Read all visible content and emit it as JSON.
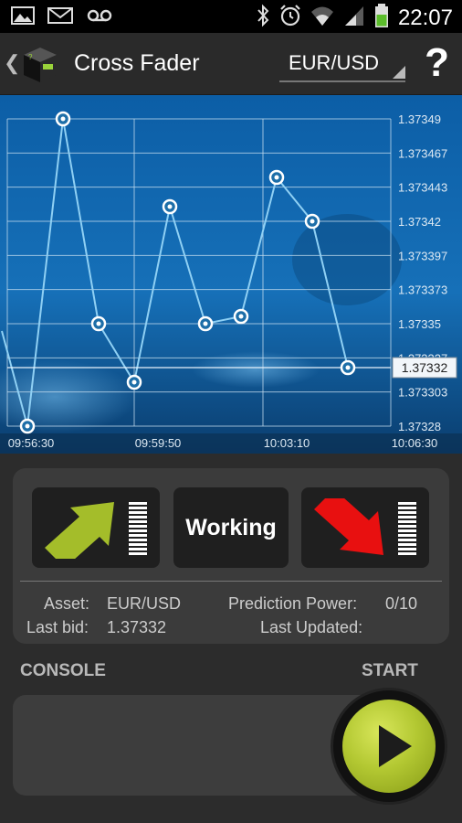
{
  "status_bar": {
    "time": "22:07",
    "left_icons": [
      "gallery-icon",
      "mail-icon",
      "voicemail-icon"
    ],
    "right_icons": [
      "bluetooth-icon",
      "alarm-icon",
      "wifi-icon",
      "signal-icon",
      "battery-icon"
    ]
  },
  "action_bar": {
    "back_glyph": "❮",
    "title": "Cross Fader",
    "asset_selected": "EUR/USD",
    "help_label": "?"
  },
  "chart_data": {
    "type": "line",
    "x_labels": [
      "09:56:30",
      "09:59:50",
      "10:03:10",
      "10:06:30"
    ],
    "y_tick_labels": [
      "1.37349",
      "1.373467",
      "1.373443",
      "1.37342",
      "1.373397",
      "1.373373",
      "1.37335",
      "1.373327",
      "1.373303",
      "1.37328"
    ],
    "ylim": [
      1.37328,
      1.37349
    ],
    "values": [
      1.373345,
      1.37328,
      1.37349,
      1.37335,
      1.37331,
      1.37343,
      1.37335,
      1.373355,
      1.37345,
      1.37342,
      1.37332
    ],
    "current_value_label": "1.37332",
    "grid": true,
    "colors": {
      "line": "#8fd0f4",
      "marker_fill": "#1d6ea8",
      "marker_ring": "#ffffff",
      "grid": "#c8dff0",
      "label": "#dde9f3"
    }
  },
  "panel": {
    "up_color": "#a4bd2a",
    "down_color": "#e81010",
    "status_text": "Working",
    "asset_label": "Asset:",
    "asset_value": "EUR/USD",
    "last_bid_label": "Last bid:",
    "last_bid_value": "1.37332",
    "prediction_label": "Prediction Power:",
    "prediction_value": "0/10",
    "last_updated_label": "Last Updated:",
    "last_updated_value": ""
  },
  "console": {
    "label": "CONSOLE",
    "start_label": "START",
    "start_color": "#b3c832"
  }
}
